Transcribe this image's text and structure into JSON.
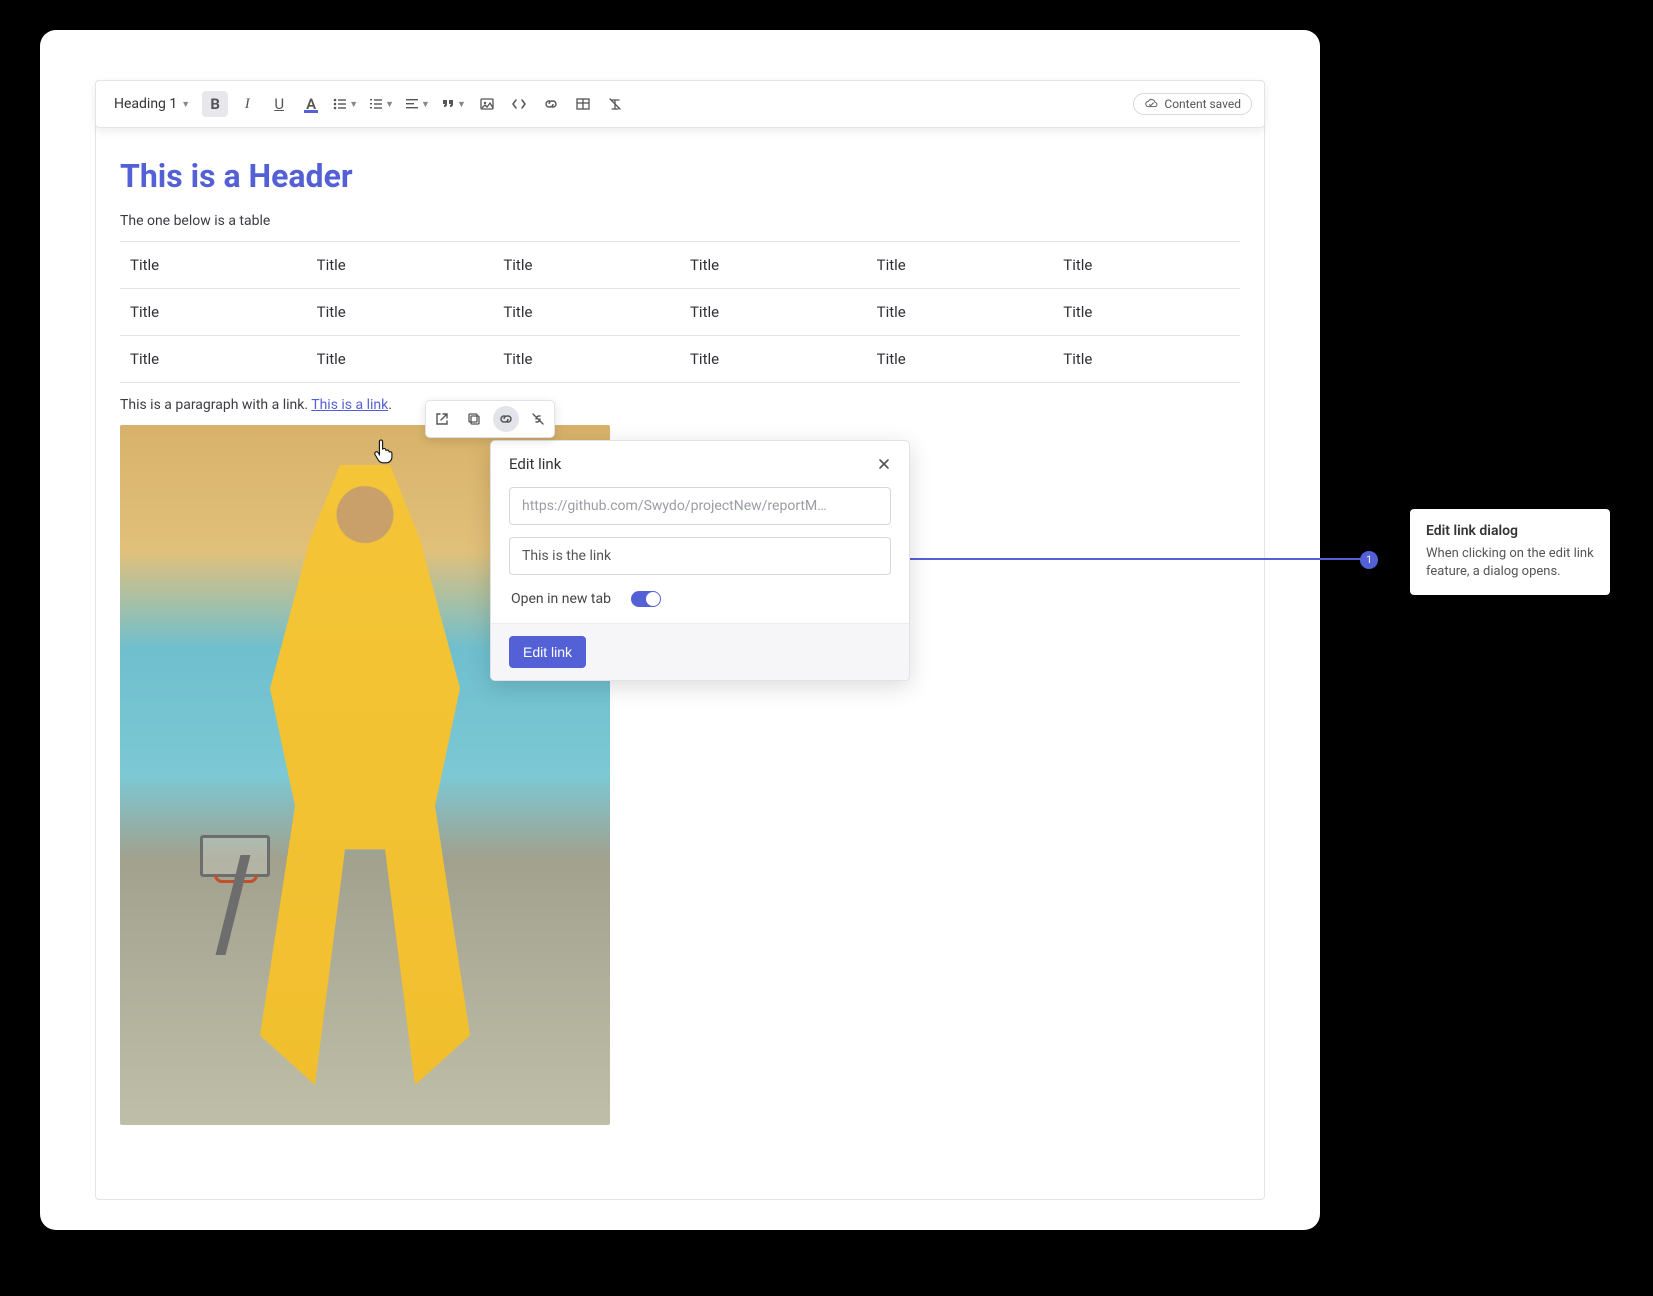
{
  "toolbar": {
    "heading_select": "Heading 1",
    "content_saved_label": "Content saved"
  },
  "doc": {
    "header": "This is a Header",
    "table_intro": "The one below is a table",
    "table_cell": "Title",
    "paragraph_prefix": "This is a paragraph with a link. ",
    "link_text": "This is a link",
    "paragraph_suffix": "."
  },
  "context_menu": {
    "icons": [
      "open-external",
      "copy",
      "link",
      "unlink"
    ],
    "active_index": 2
  },
  "dialog": {
    "title": "Edit link",
    "url_value": "https://github.com/Swydo/projectNew/reportM…",
    "text_value": "This is the link",
    "open_new_tab_label": "Open in new tab",
    "open_new_tab_on": true,
    "submit_label": "Edit link"
  },
  "annotation": {
    "marker": "1",
    "title": "Edit link dialog",
    "body": "When clicking on the edit link feature, a dialog opens."
  }
}
